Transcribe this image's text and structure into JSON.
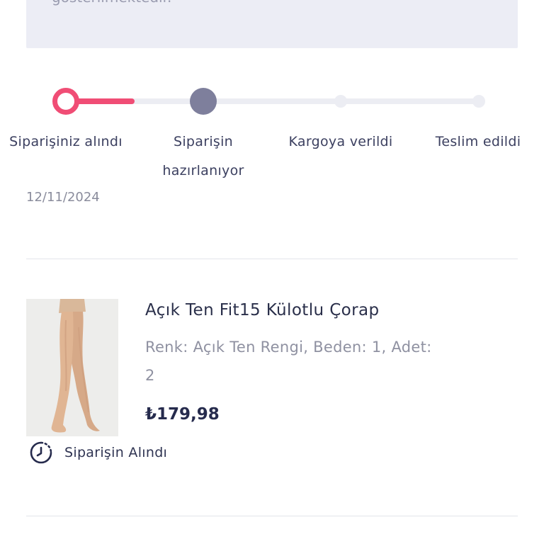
{
  "notice": {
    "text": "gösterilmektedir."
  },
  "tracker": {
    "steps": [
      {
        "label": "Siparişiniz alındı",
        "date": "12/11/2024"
      },
      {
        "label": "Siparişin hazırlanıyor"
      },
      {
        "label": "Kargoya verildi"
      },
      {
        "label": "Teslim edildi"
      }
    ]
  },
  "product": {
    "title": "Açık Ten Fit15 Külotlu Çorap",
    "meta": "Renk: Açık Ten Rengi, Beden: 1, Adet: 2",
    "price": "₺179,98",
    "status": "Siparişin Alındı",
    "image_icon": "pantyhose-legs-image",
    "status_icon": "clock-icon"
  },
  "colors": {
    "accent": "#f04d75",
    "step_done": "#7e7f9c",
    "track": "#ecedf3",
    "notice_bg": "#ecedf5"
  }
}
